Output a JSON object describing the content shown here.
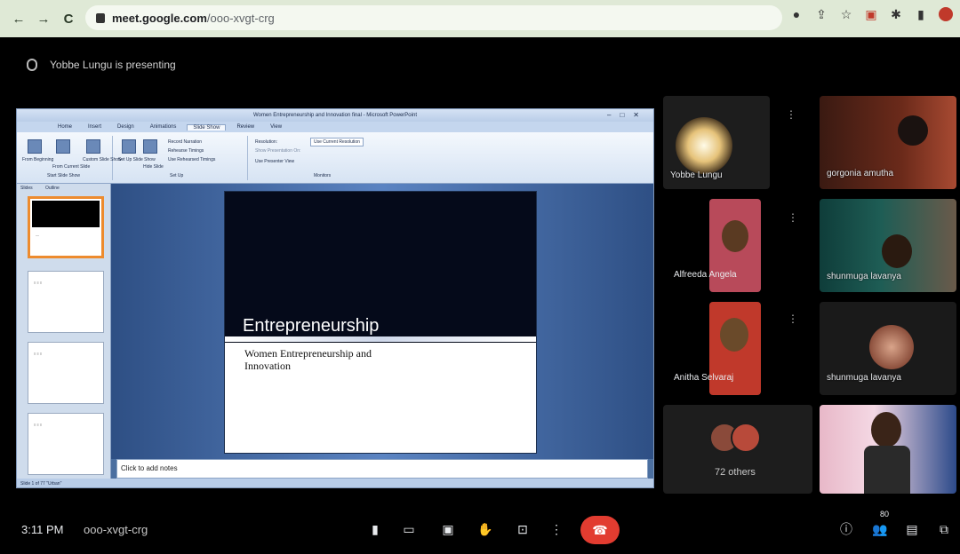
{
  "browser": {
    "url_domain": "meet.google.com",
    "url_path": "/ooo-xvgt-crg"
  },
  "meet": {
    "presenting_text": "Yobbe Lungu is presenting",
    "time": "3:11 PM",
    "meeting_code": "ooo-xvgt-crg",
    "people_count": "80",
    "others_text": "72 others",
    "hangup_color": "#e23c30"
  },
  "participants": [
    {
      "name": "Yobbe Lungu"
    },
    {
      "name": "gorgonia amutha"
    },
    {
      "name": "Alfreeda Angela"
    },
    {
      "name": "shunmuga lavanya"
    },
    {
      "name": "Anitha Selvaraj"
    },
    {
      "name": "shunmuga lavanya"
    }
  ],
  "powerpoint": {
    "window_title": "Women Entrepreneurship and Innovation final - Microsoft PowerPoint",
    "tabs": [
      "Home",
      "Insert",
      "Design",
      "Animations",
      "Slide Show",
      "Review",
      "View"
    ],
    "active_tab": "Slide Show",
    "ribbon": {
      "from_beginning": "From Beginning",
      "from_current": "From Current Slide",
      "custom_show": "Custom Slide Show",
      "setup_show": "Set Up Slide Show",
      "hide_slide": "Hide Slide",
      "record_narration": "Record Narration",
      "rehearse_timings": "Rehearse Timings",
      "use_rehearsed": "Use Rehearsed Timings",
      "resolution": "Resolution:",
      "resolution_value": "Use Current Resolution",
      "show_on": "Show Presentation On:",
      "presenter_view": "Use Presenter View",
      "group_start": "Start Slide Show",
      "group_setup": "Set Up",
      "group_monitors": "Monitors"
    },
    "panel_tabs": [
      "Slides",
      "Outline"
    ],
    "slide_title": "Entrepreneurship",
    "slide_subtitle": "Women Entrepreneurship and Innovation",
    "notes_placeholder": "Click to add notes",
    "status": "Slide 1 of 77   \"Urban\""
  }
}
